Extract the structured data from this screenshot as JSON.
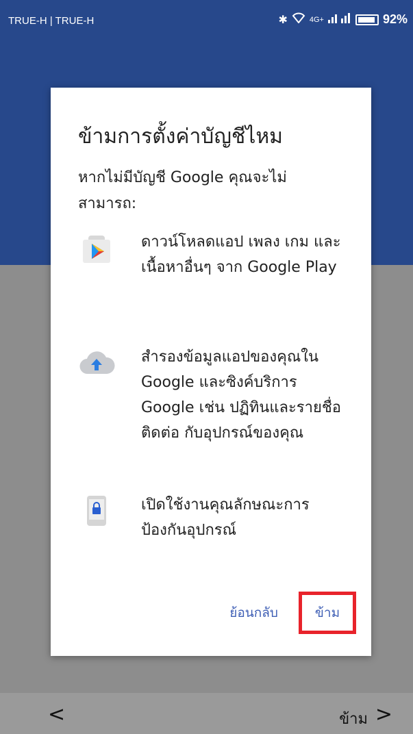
{
  "status_bar": {
    "carrier": "TRUE-H | TRUE-H",
    "network_label": "4G+",
    "battery": "92%"
  },
  "dialog": {
    "title": "ข้ามการตั้งค่าบัญชีไหม",
    "intro": "หากไม่มีบัญชี Google คุณจะไม่สามารถ:",
    "features": [
      {
        "icon": "play-store-icon",
        "text": "ดาวน์โหลดแอป เพลง เกม และเนื้อหาอื่นๆ จาก Google Play"
      },
      {
        "icon": "cloud-upload-icon",
        "text": "สำรองข้อมูลแอปของคุณใน Google และซิงค์บริการ Google เช่น ปฏิทินและรายชื่อติดต่อ กับอุปกรณ์ของคุณ"
      },
      {
        "icon": "phone-lock-icon",
        "text": "เปิดใช้งานคุณลักษณะการป้องกันอุปกรณ์"
      }
    ],
    "back_label": "ย้อนกลับ",
    "skip_label": "ข้าม"
  },
  "bottom_nav": {
    "back_symbol": "<",
    "skip_label": "ข้าม",
    "next_symbol": ">"
  },
  "colors": {
    "header": "#27488b",
    "accent_button": "#3f5fb5",
    "highlight_box": "#e8232b"
  }
}
